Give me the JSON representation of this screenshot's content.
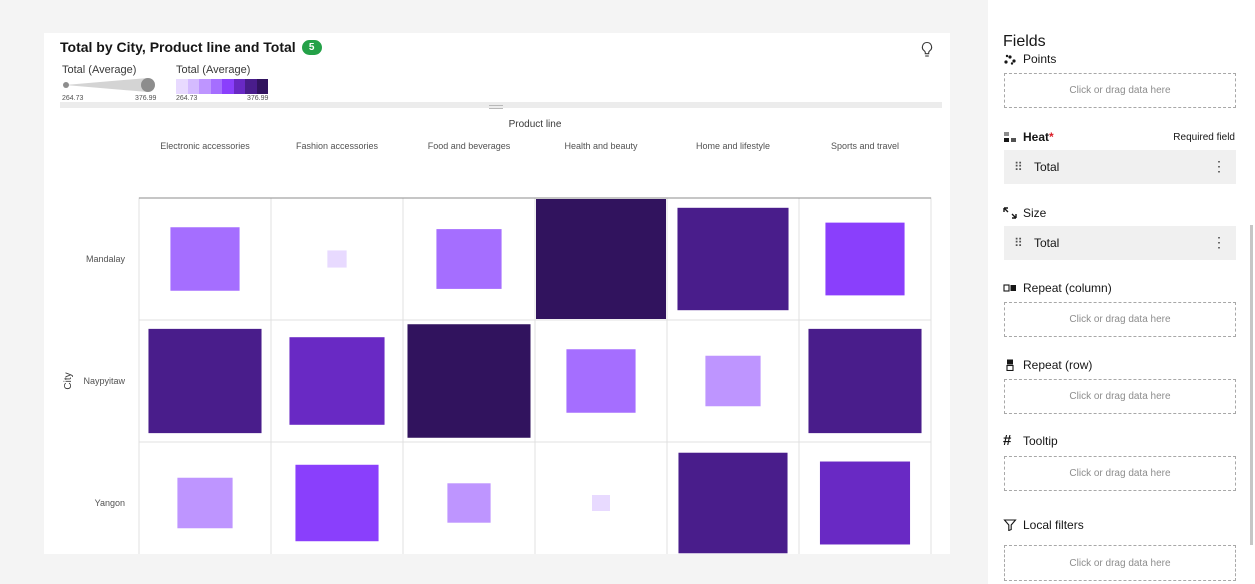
{
  "card": {
    "title": "Total by City, Product line and Total",
    "badge": "5",
    "legend_size": {
      "title": "Total (Average)",
      "min": "264.73",
      "max": "376.99"
    },
    "legend_color": {
      "title": "Total (Average)",
      "min": "264.73",
      "max": "376.99",
      "swatches": [
        "#e8daff",
        "#d4bbff",
        "#be95ff",
        "#a56eff",
        "#8a3ffc",
        "#6929c4",
        "#491d8b",
        "#31135e"
      ]
    }
  },
  "chart_data": {
    "type": "heatmap",
    "x_title": "Product line",
    "y_title": "City",
    "categories": [
      "Electronic accessories",
      "Fashion accessories",
      "Food and beverages",
      "Health and beauty",
      "Home and lifestyle",
      "Sports and travel"
    ],
    "rows": [
      "Mandalay",
      "Naypyitaw",
      "Yangon"
    ],
    "values": [
      [
        316,
        266,
        312,
        377,
        358,
        326
      ],
      [
        360,
        342,
        370,
        316,
        302,
        360
      ],
      [
        302,
        330,
        290,
        264,
        356,
        337
      ]
    ],
    "value_range": [
      264.73,
      376.99
    ]
  },
  "panel": {
    "title": "Fields",
    "sections": [
      {
        "label": "Points",
        "type": "drop",
        "placeholder": "Click or drag data here"
      },
      {
        "label": "Heat",
        "required_mark": "*",
        "required_text": "Required field",
        "type": "pill",
        "value": "Total"
      },
      {
        "label": "Size",
        "type": "pill",
        "value": "Total"
      },
      {
        "label": "Repeat (column)",
        "type": "drop",
        "placeholder": "Click or drag data here"
      },
      {
        "label": "Repeat (row)",
        "type": "drop",
        "placeholder": "Click or drag data here"
      },
      {
        "label": "Tooltip",
        "type": "drop",
        "placeholder": "Click or drag data here"
      },
      {
        "label": "Local filters",
        "type": "drop",
        "placeholder": "Click or drag data here"
      }
    ]
  }
}
